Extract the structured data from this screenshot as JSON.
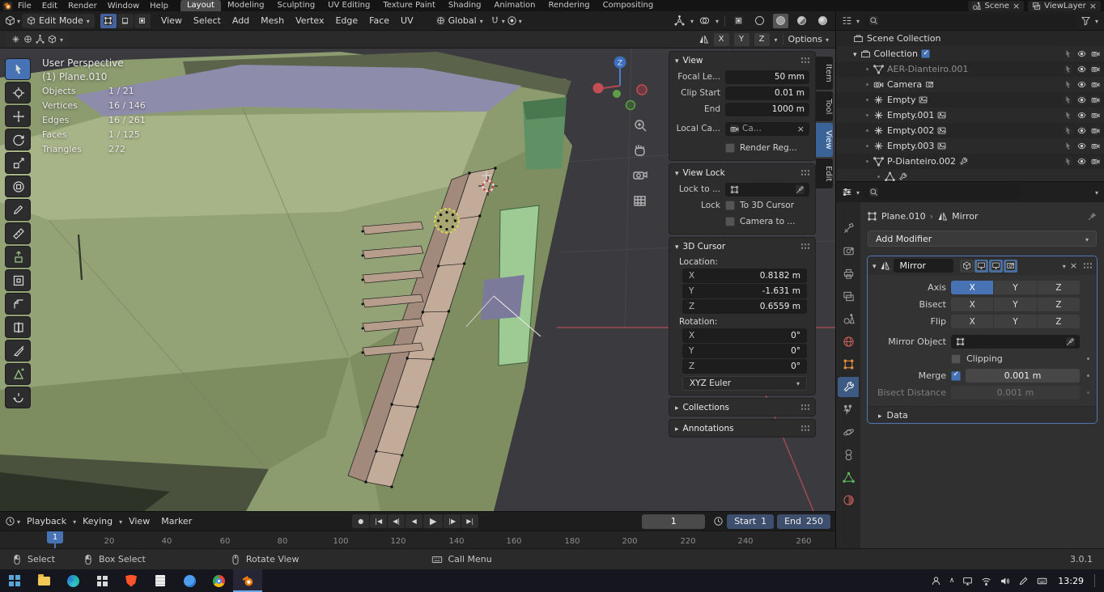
{
  "topbar": {
    "menus": [
      "File",
      "Edit",
      "Render",
      "Window",
      "Help"
    ],
    "workspaces": [
      "Layout",
      "Modeling",
      "Sculpting",
      "UV Editing",
      "Texture Paint",
      "Shading",
      "Animation",
      "Rendering",
      "Compositing"
    ],
    "scene": "Scene",
    "viewlayer": "ViewLayer"
  },
  "viewport_header": {
    "mode": "Edit Mode",
    "menus": [
      "View",
      "Select",
      "Add",
      "Mesh",
      "Vertex",
      "Edge",
      "Face",
      "UV"
    ],
    "orientation": "Global",
    "mirror_axes": [
      "X",
      "Y",
      "Z"
    ],
    "options": "Options"
  },
  "viewport": {
    "perspective": "User Perspective",
    "object": "(1) Plane.010",
    "stats": [
      {
        "label": "Objects",
        "value": "1 / 21"
      },
      {
        "label": "Vertices",
        "value": "16 / 146"
      },
      {
        "label": "Edges",
        "value": "16 / 261"
      },
      {
        "label": "Faces",
        "value": "1 / 125"
      },
      {
        "label": "Triangles",
        "value": "272"
      }
    ],
    "gizmo_axis": "Z"
  },
  "npanel": {
    "tabs": [
      "Item",
      "Tool",
      "View",
      "Edit"
    ],
    "view": {
      "title": "View",
      "rows": [
        {
          "label": "Focal Le...",
          "value": "50 mm"
        },
        {
          "label": "Clip Start",
          "value": "0.01 m"
        },
        {
          "label": "End",
          "value": "1000 m"
        }
      ],
      "local_camera_label": "Local Ca...",
      "local_camera_value": "Ca...",
      "render_region": "Render Reg..."
    },
    "view_lock": {
      "title": "View Lock",
      "lock_to": "Lock to ...",
      "lock": "Lock",
      "to_3d_cursor": "To 3D Cursor",
      "camera_to": "Camera to ..."
    },
    "cursor": {
      "title": "3D Cursor",
      "location_label": "Location:",
      "rotation_label": "Rotation:",
      "location": [
        {
          "axis": "X",
          "value": "0.8182 m"
        },
        {
          "axis": "Y",
          "value": "-1.631 m"
        },
        {
          "axis": "Z",
          "value": "0.6559 m"
        }
      ],
      "rotation": [
        {
          "axis": "X",
          "value": "0°"
        },
        {
          "axis": "Y",
          "value": "0°"
        },
        {
          "axis": "Z",
          "value": "0°"
        }
      ],
      "euler": "XYZ Euler"
    },
    "collections": "Collections",
    "annotations": "Annotations"
  },
  "outliner": {
    "scene_collection": "Scene Collection",
    "collection": "Collection",
    "items": [
      "AER-Dianteiro.001",
      "Camera",
      "Empty",
      "Empty.001",
      "Empty.002",
      "Empty.003",
      "P-Dianteiro.002"
    ]
  },
  "properties": {
    "breadcrumb": {
      "object": "Plane.010",
      "separator": "›",
      "modifier": "Mirror"
    },
    "add_modifier": "Add Modifier",
    "modifier": {
      "name": "Mirror",
      "axis_label": "Axis",
      "bisect_label": "Bisect",
      "flip_label": "Flip",
      "axes": [
        "X",
        "Y",
        "Z"
      ],
      "mirror_object_label": "Mirror Object",
      "clipping_label": "Clipping",
      "merge_label": "Merge",
      "merge_value": "0.001 m",
      "bisect_distance_label": "Bisect Distance",
      "bisect_distance_value": "0.001 m",
      "data_label": "Data"
    }
  },
  "timeline": {
    "menus": [
      "Playback",
      "Keying",
      "View",
      "Marker"
    ],
    "current_frame": "1",
    "start_label": "Start",
    "start_value": "1",
    "end_label": "End",
    "end_value": "250",
    "ticks": [
      "20",
      "40",
      "60",
      "80",
      "100",
      "120",
      "140",
      "160",
      "180",
      "200",
      "220",
      "240",
      "260"
    ]
  },
  "statusbar": {
    "hints": [
      "Select",
      "Box Select",
      "Rotate View",
      "Call Menu"
    ],
    "version": "3.0.1"
  },
  "taskbar": {
    "time": "13:29"
  },
  "colors": {
    "accent": "#4772b3",
    "body_green": "#8d9c6f",
    "select_yellow": "#e8dc4e",
    "cursor_red": "#c23f3f"
  }
}
